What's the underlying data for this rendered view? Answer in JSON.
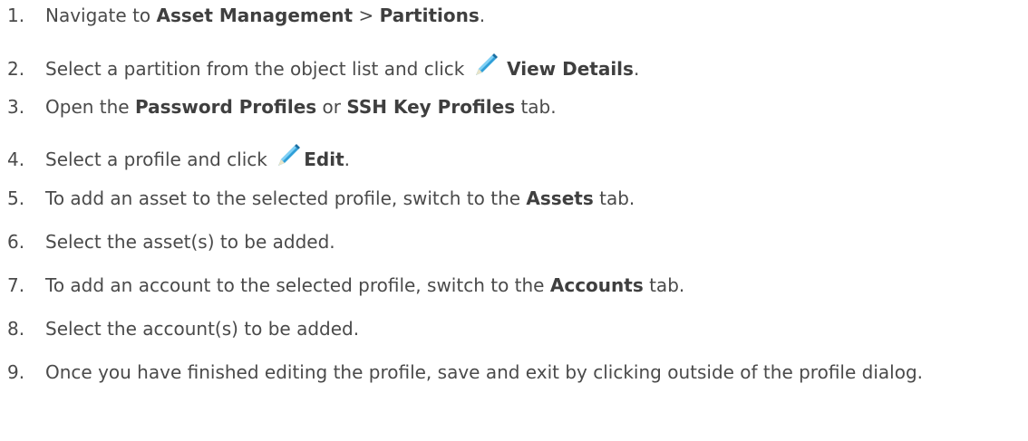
{
  "steps": [
    {
      "number": "1.",
      "pre": "Navigate to ",
      "bold1": "Asset Management",
      "mid": " > ",
      "bold2": "Partitions",
      "post": "."
    },
    {
      "number": "2.",
      "pre": "Select a partition from the object list and click ",
      "icon": "pencil-edit-icon",
      "bold1": "View Details",
      "post": "."
    },
    {
      "number": "3.",
      "pre": "Open the ",
      "bold1": "Password Profiles",
      "mid": " or ",
      "bold2": "SSH Key Profiles",
      "post": " tab."
    },
    {
      "number": "4.",
      "pre": "Select a profile and click ",
      "icon": "pencil-edit-icon",
      "bold1": "Edit",
      "post": "."
    },
    {
      "number": "5.",
      "pre": "To add an asset to the selected profile, switch to the ",
      "bold1": "Assets",
      "post": " tab."
    },
    {
      "number": "6.",
      "text": "Select the asset(s) to be added."
    },
    {
      "number": "7.",
      "pre": "To add an account to the selected profile, switch to the ",
      "bold1": "Accounts",
      "post": " tab."
    },
    {
      "number": "8.",
      "text": "Select the account(s) to be added."
    },
    {
      "number": "9.",
      "text": "Once you have finished editing the profile, save and exit by clicking outside of the profile dialog."
    }
  ],
  "colors": {
    "text": "#4a4a4a",
    "pencil_blue": "#2f9fd8"
  }
}
